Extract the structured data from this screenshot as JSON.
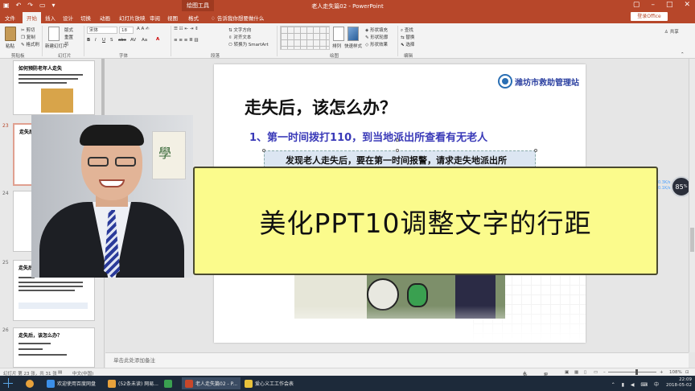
{
  "titlebar": {
    "doc_title": "老人走失篇02 - PowerPoint",
    "tool_tab": "绘图工具"
  },
  "tabs": {
    "file": "文件",
    "home": "开始",
    "insert": "插入",
    "design": "设计",
    "transitions": "切换",
    "animations": "动画",
    "slideshow": "幻灯片放映",
    "review": "审阅",
    "view": "视图",
    "format": "格式",
    "tell_me": "告诉我你想要做什么",
    "login": "登录Office",
    "share": "共享"
  },
  "ribbon": {
    "clipboard": {
      "label": "剪贴板",
      "paste": "粘贴",
      "cut": "剪切",
      "copy": "复制",
      "format_painter": "格式刷"
    },
    "slides": {
      "label": "幻灯片",
      "new_slide": "新建幻灯片",
      "layout": "版式",
      "reset": "重置",
      "section": "节"
    },
    "font": {
      "label": "字体",
      "font_name": "宋体",
      "font_size": "18"
    },
    "paragraph": {
      "label": "段落",
      "text_direction": "文字方向",
      "align_text": "对齐文本",
      "smartart": "转换为 SmartArt"
    },
    "drawing": {
      "label": "绘图",
      "arrange": "排列",
      "quick_styles": "快速样式",
      "shape_fill": "形状填充",
      "shape_outline": "形状轮廓",
      "shape_effects": "形状效果"
    },
    "editing": {
      "label": "编辑",
      "find": "查找",
      "replace": "替换",
      "select": "选择"
    }
  },
  "thumbnails": {
    "slides": [
      {
        "num": "",
        "title": "如何预防老年人走失"
      },
      {
        "num": "23",
        "title": "走失后"
      },
      {
        "num": "24",
        "title": ""
      },
      {
        "num": "25",
        "title": "走失后"
      },
      {
        "num": "26",
        "title": "走失后，该怎么办？"
      }
    ]
  },
  "slide": {
    "title": "走失后，该怎么办？",
    "step": "1、第一时间拨打110，到当地派出所查看有无老人",
    "textbox": "发现老人走失后，要在第一时间报警，请求走失地派出所",
    "logo_name": "潍坊市救助管理站"
  },
  "video": {
    "poster_char": "學"
  },
  "banner": {
    "text": "美化PPT10调整文字的行距"
  },
  "badge": {
    "value": "85",
    "unit": "%",
    "side_top": "0.3K/s",
    "side_bottom": "0.1K/s"
  },
  "notes": {
    "placeholder": "单击此处添加备注"
  },
  "status": {
    "slide_info": "幻灯片 第 23 张，共 31 张",
    "language": "中文(中国)",
    "notes_btn": "备注",
    "comments_btn": "批注",
    "zoom": "108%"
  },
  "taskbar": {
    "tasks": [
      {
        "label": "欢迎使用百度网盘",
        "color": "#3b8fe8"
      },
      {
        "label": "(52条未读) 网易...",
        "color": "#e8a23b"
      },
      {
        "label": "",
        "color": "#3aa050"
      },
      {
        "label": "老人走失篇02 - P...",
        "color": "#c8472a"
      },
      {
        "label": "爱心义工工作会表",
        "color": "#e8c23b"
      }
    ],
    "time": "22:09",
    "date": "2018-05-02"
  },
  "colors": {
    "accent": "#b7472a",
    "banner": "#fbfb8c",
    "step_text": "#3a3ab8"
  }
}
